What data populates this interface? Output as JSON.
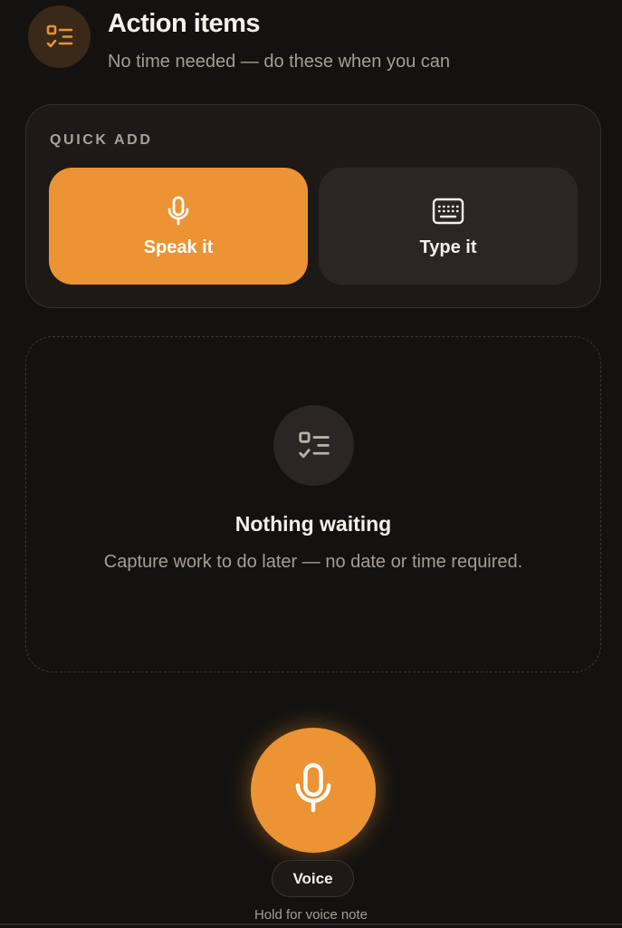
{
  "header": {
    "icon": "checklist-icon",
    "title": "Action items",
    "subtitle": "No time needed — do these when you can"
  },
  "quick_add": {
    "label": "QUICK ADD",
    "speak": {
      "label": "Speak it",
      "icon": "microphone-icon"
    },
    "type": {
      "label": "Type it",
      "icon": "keyboard-icon"
    }
  },
  "empty_state": {
    "icon": "checklist-icon",
    "title": "Nothing waiting",
    "text": "Capture work to do later — no date or time required."
  },
  "voice": {
    "icon": "microphone-icon",
    "label": "Voice",
    "hint": "Hold for voice note"
  },
  "colors": {
    "background": "#141210",
    "accent": "#ec9333",
    "card": "#1c1917",
    "muted_text": "#a49d95"
  }
}
